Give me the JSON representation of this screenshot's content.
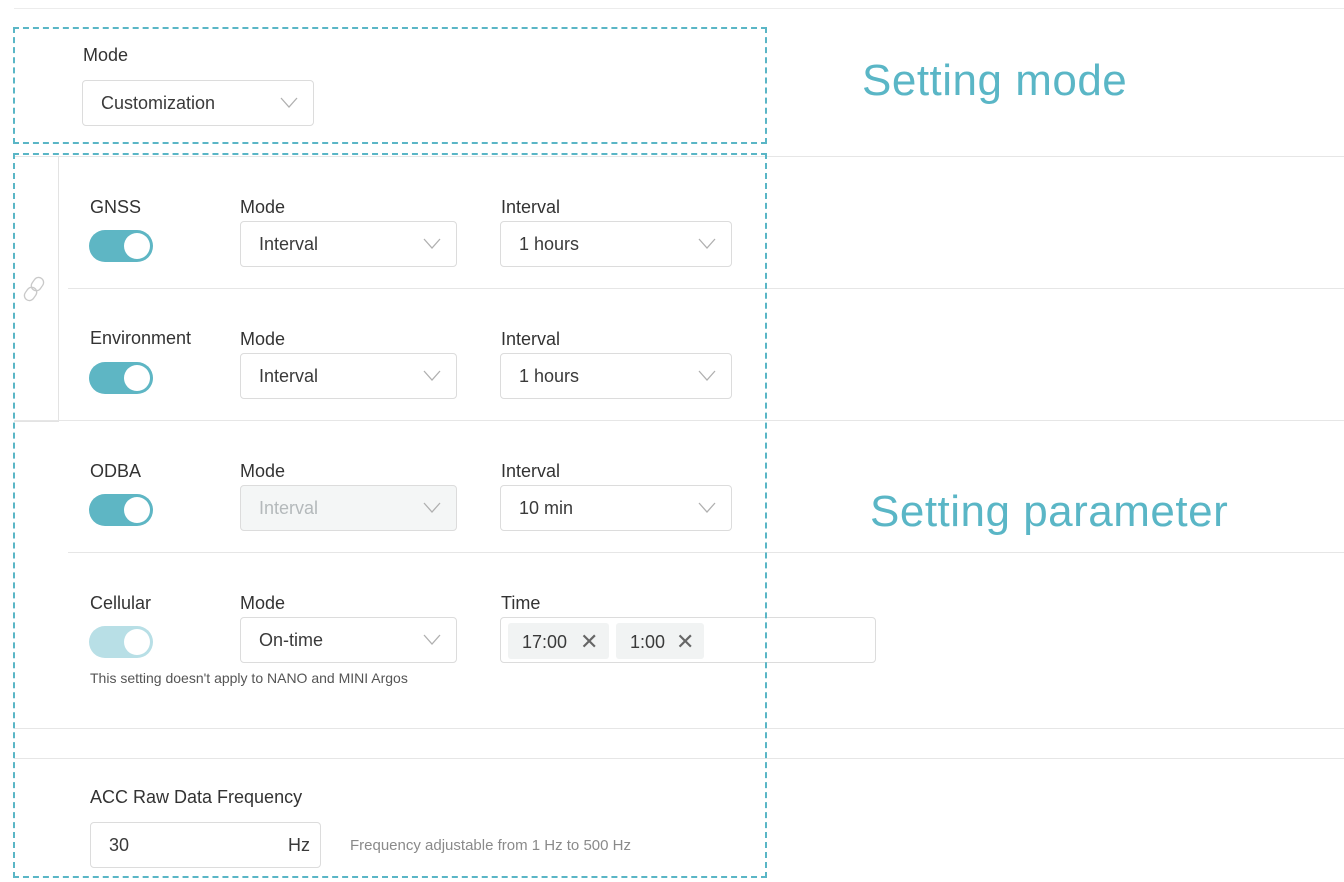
{
  "mode_section": {
    "label": "Mode",
    "value": "Customization"
  },
  "annotations": {
    "setting_mode": "Setting mode",
    "setting_parameter": "Setting parameter"
  },
  "gnss": {
    "name": "GNSS",
    "mode_label": "Mode",
    "mode_value": "Interval",
    "interval_label": "Interval",
    "interval_value": "1 hours",
    "enabled": true
  },
  "environment": {
    "name": "Environment",
    "mode_label": "Mode",
    "mode_value": "Interval",
    "interval_label": "Interval",
    "interval_value": "1 hours",
    "enabled": true
  },
  "odba": {
    "name": "ODBA",
    "mode_label": "Mode",
    "mode_value": "Interval",
    "mode_disabled": true,
    "interval_label": "Interval",
    "interval_value": "10 min",
    "enabled": true
  },
  "cellular": {
    "name": "Cellular",
    "mode_label": "Mode",
    "mode_value": "On-time",
    "time_label": "Time",
    "times": [
      "17:00",
      "1:00"
    ],
    "note": "This setting doesn't apply to NANO and MINI Argos",
    "enabled": true,
    "toggle_faded": true
  },
  "acc": {
    "label": "ACC Raw Data Frequency",
    "value": "30",
    "unit": "Hz",
    "hint": "Frequency adjustable from 1 Hz to 500 Hz"
  },
  "icons": {
    "chevron": "chevron-down-icon",
    "link": "link-icon",
    "remove": "close-icon"
  },
  "colors": {
    "accent": "#5eb6c4",
    "annotation": "#5ab6c6"
  }
}
